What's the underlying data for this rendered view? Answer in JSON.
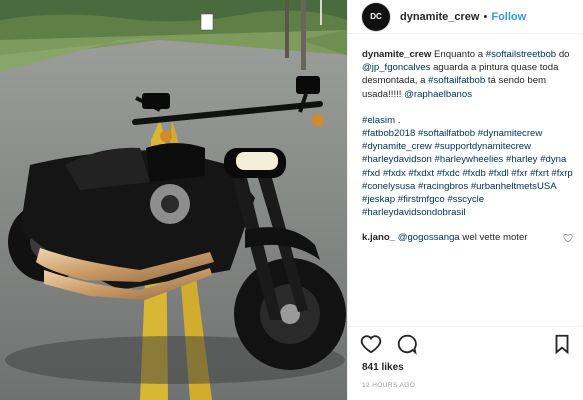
{
  "post": {
    "username": "dynamite_crew",
    "avatar_text": "DC",
    "separator": "•",
    "follow_label": "Follow",
    "image_alt": "Harley-Davidson Fat Bob motorcycle parked on a road"
  },
  "caption": {
    "username": "dynamite_crew",
    "segments": [
      {
        "type": "text",
        "text": " Enquanto a "
      },
      {
        "type": "tag",
        "text": "#softailstreetbob"
      },
      {
        "type": "text",
        "text": " do "
      },
      {
        "type": "tag",
        "text": "@jp_fgoncalves"
      },
      {
        "type": "text",
        "text": " aguarda a pintura quase toda desmontada, a "
      },
      {
        "type": "tag",
        "text": "#softailfatbob"
      },
      {
        "type": "text",
        "text": " tá sendo bem usada!!!!! "
      },
      {
        "type": "tag",
        "text": "@raphaelbanos"
      }
    ],
    "hashtags": [
      "#elasim",
      ".",
      "#fatbob2018",
      "#softailfatbob",
      "#dynamitecrew",
      "#dynamite_crew",
      "#supportdynamitecrew",
      "#harleydavidson",
      "#harleywheelies",
      "#harley",
      "#dyna",
      "#fxd",
      "#fxdx",
      "#fxdxt",
      "#fxdc",
      "#fxdb",
      "#fxdl",
      "#fxr",
      "#fxrt",
      "#fxrp",
      "#conelysusa",
      "#racingbros",
      "#urbanheltmetsUSA",
      "#jeskap",
      "#firstmfgco",
      "#sscycle",
      "#harleydavidsondobrasil"
    ]
  },
  "comment": {
    "username": "k.jano_",
    "mention": "@gogossanga",
    "text": " wel vette moter"
  },
  "actions": {
    "likes": "841 likes",
    "time": "12 HOURS AGO"
  }
}
